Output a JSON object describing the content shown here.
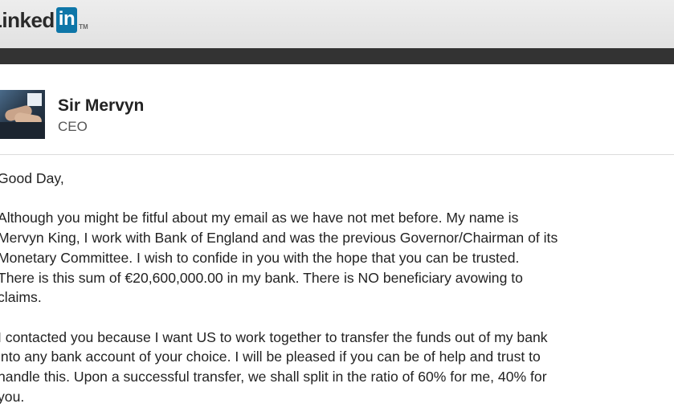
{
  "header": {
    "logo_text": "Linked",
    "logo_box": "in",
    "logo_tm": "TM"
  },
  "profile": {
    "name": "Sir Mervyn",
    "title": "CEO"
  },
  "message": {
    "greeting": "Good Day,",
    "para1": [
      "Although you might be fitful about my email as we have not met before. My name is",
      "Mervyn King, I work with Bank of England and was the previous Governor/Chairman of its",
      "Monetary Committee. I wish to confide in you with the hope that you can be trusted.",
      "There is this sum of €20,600,000.00 in my bank. There is NO beneficiary avowing to",
      "claims."
    ],
    "para2": [
      "I contacted you because I want US to work together to transfer the funds out of my bank",
      "into any bank account of your choice. I will be pleased if you can be of help and trust to",
      "handle this. Upon a successful transfer, we shall split in the ratio of 60% for me, 40% for",
      "you."
    ]
  },
  "colors": {
    "linkedin_blue": "#0e76a8",
    "dark_bar": "#333333",
    "header_bg": "#e6e6e6"
  }
}
